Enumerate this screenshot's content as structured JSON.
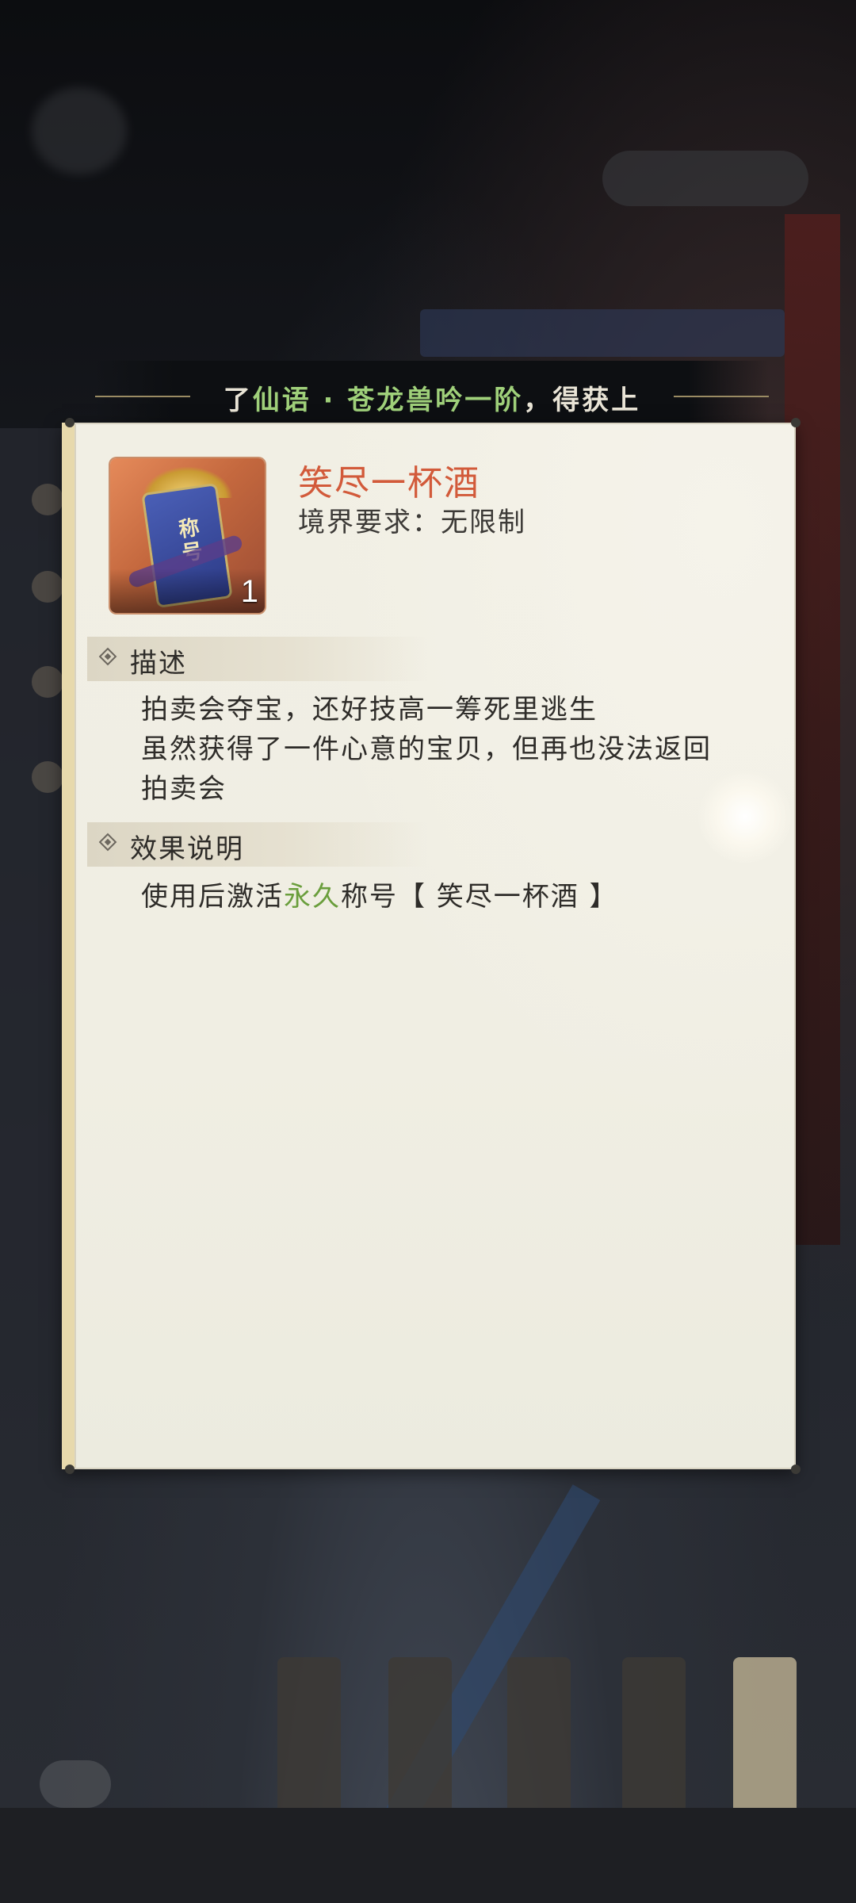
{
  "notice": {
    "prefix": "了",
    "highlight": "仙语 · 苍龙兽吟一阶",
    "suffix": "，得获上"
  },
  "item": {
    "name": "笑尽一杯酒",
    "requirement": "境界要求：无限制",
    "count": "1",
    "icon": "title-badge-icon",
    "icon_label": "称号"
  },
  "sections": {
    "description": {
      "title": "描述",
      "lines": [
        "拍卖会夺宝，还好技高一筹死里逃生",
        "虽然获得了一件心意的宝贝，但再也没法返回",
        "拍卖会"
      ]
    },
    "effect": {
      "title": "效果说明",
      "prefix": "使用后激活",
      "highlight": "永久",
      "suffix": "称号【 笑尽一杯酒 】"
    }
  },
  "colors": {
    "item_name": "#d25a3a",
    "highlight_green": "#6a9e3c",
    "notice_green": "#9fd07a"
  }
}
